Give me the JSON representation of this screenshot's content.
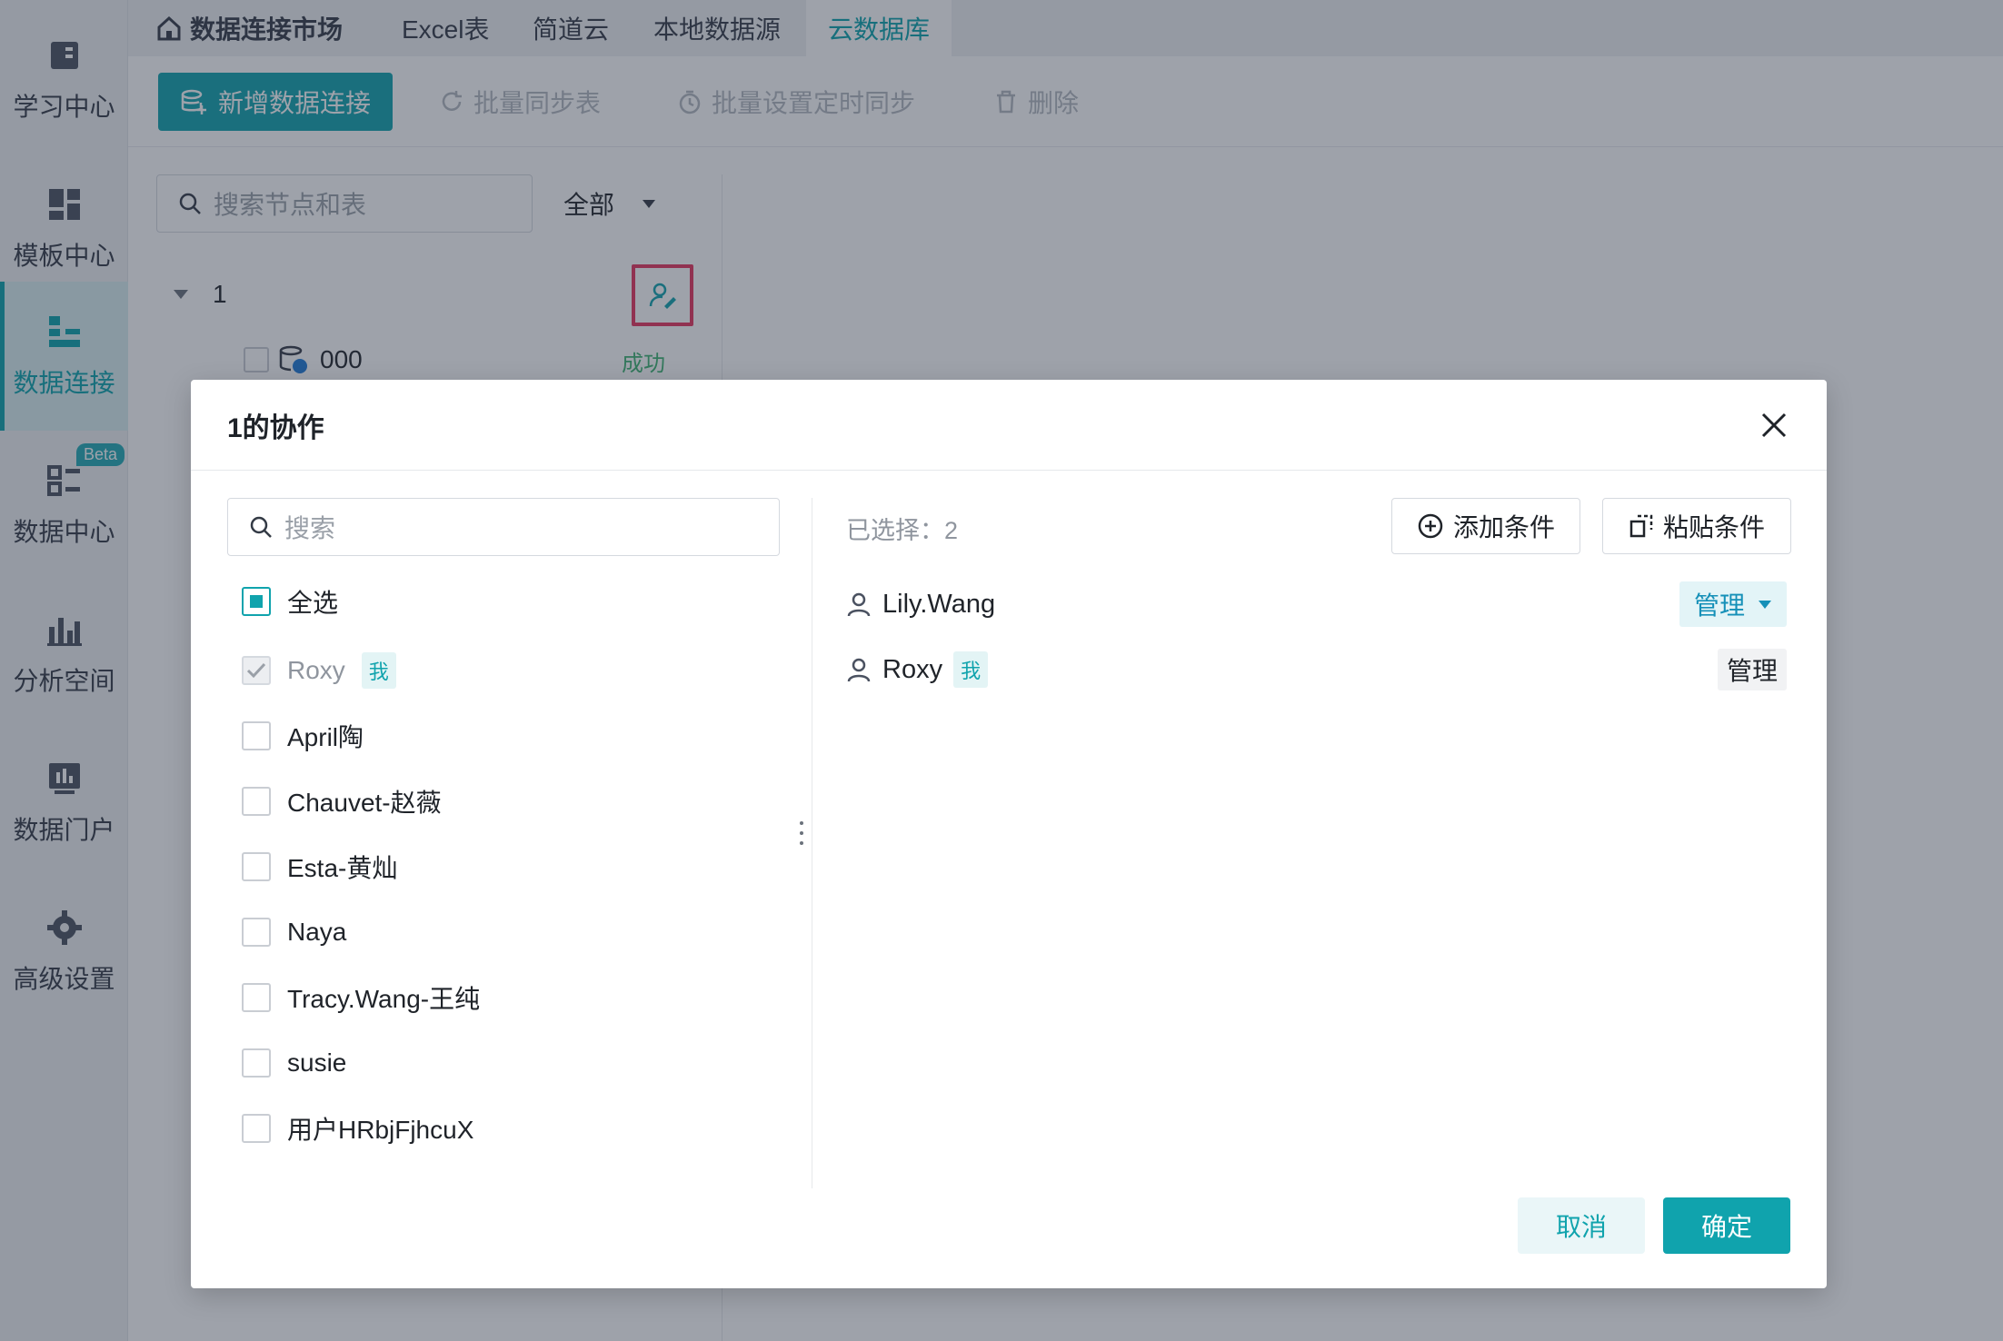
{
  "sidebar": {
    "items": [
      {
        "label": "学习中心",
        "icon": "book-icon"
      },
      {
        "label": "模板中心",
        "icon": "template-icon"
      },
      {
        "label": "数据连接",
        "icon": "data-connection-icon",
        "active": true
      },
      {
        "label": "数据中心",
        "icon": "data-center-icon",
        "badge": "Beta"
      },
      {
        "label": "分析空间",
        "icon": "analysis-icon"
      },
      {
        "label": "数据门户",
        "icon": "portal-icon"
      },
      {
        "label": "高级设置",
        "icon": "settings-gear-icon"
      }
    ]
  },
  "tabs": {
    "home": "数据连接市场",
    "items": [
      "Excel表",
      "简道云",
      "本地数据源",
      "云数据库"
    ]
  },
  "toolbar": {
    "add": "新增数据连接",
    "batch_sync": "批量同步表",
    "schedule": "批量设置定时同步",
    "delete": "删除"
  },
  "tree": {
    "search_placeholder": "搜索节点和表",
    "filter": "全部",
    "node_label": "1",
    "child_label": "000",
    "child_status": "成功"
  },
  "dialog": {
    "title": "1的协作",
    "search_placeholder": "搜索",
    "select_all": "全选",
    "me_tag": "我",
    "users": [
      "Roxy",
      "April陶",
      "Chauvet-赵薇",
      "Esta-黄灿",
      "Naya",
      "Tracy.Wang-王纯",
      "susie",
      "用户HRbjFjhcuX"
    ],
    "selected_label": "已选择：2",
    "add_condition": "添加条件",
    "paste_condition": "粘贴条件",
    "selected": [
      {
        "name": "Lily.Wang",
        "permission": "管理"
      },
      {
        "name": "Roxy",
        "permission": "管理"
      }
    ],
    "cancel": "取消",
    "confirm": "确定"
  },
  "colors": {
    "accent": "#10a3ad",
    "highlight_border": "#e8345e",
    "success": "#3cb371"
  }
}
